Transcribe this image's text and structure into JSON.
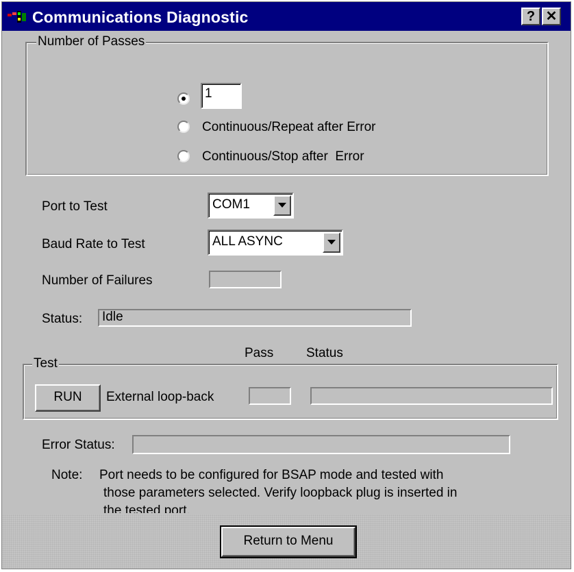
{
  "window": {
    "title": "Communications Diagnostic",
    "help_label": "?",
    "close_label": "✕"
  },
  "passes": {
    "group_label": "Number of Passes",
    "count_value": "1",
    "options": [
      {
        "label": "",
        "checked": true
      },
      {
        "label": "Continuous/Repeat after Error",
        "checked": false
      },
      {
        "label": "Continuous/Stop after  Error",
        "checked": false
      }
    ]
  },
  "port": {
    "label": "Port to Test",
    "selected": "COM1"
  },
  "baud": {
    "label": "Baud Rate to Test",
    "selected": "ALL ASYNC"
  },
  "failures": {
    "label": "Number of Failures",
    "value": ""
  },
  "status": {
    "label": "Status:",
    "value": "Idle"
  },
  "test": {
    "group_label": "Test",
    "pass_header": "Pass",
    "status_header": "Status",
    "run_label": "RUN",
    "row_label": "External loop-back",
    "pass_value": "",
    "status_value": ""
  },
  "error_status": {
    "label": "Error Status:",
    "value": ""
  },
  "note": {
    "label": "Note:",
    "line1": "Port needs to be configured for BSAP mode and tested with",
    "line2": "those parameters selected. Verify loopback plug is inserted in",
    "line3": "the tested port."
  },
  "footer": {
    "return_label": "Return to Menu"
  }
}
